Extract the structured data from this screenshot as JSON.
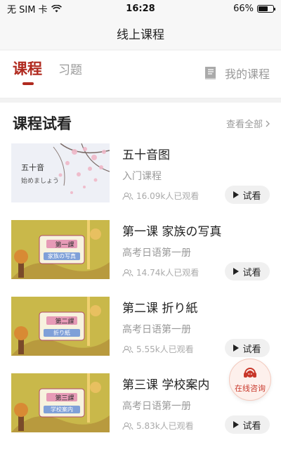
{
  "status_bar": {
    "carrier": "无 SIM 卡",
    "time": "16:28",
    "battery": "66%",
    "battery_level": 0.66
  },
  "nav": {
    "title": "线上课程"
  },
  "tabs": {
    "active": "课程",
    "other": "习题",
    "my_courses": "我的课程"
  },
  "section": {
    "title": "课程试看",
    "view_all": "查看全部"
  },
  "courses": [
    {
      "title": "五十音图",
      "subtitle": "入门课程",
      "views": "16.09k人已观看",
      "button": "试看",
      "thumb": {
        "main": "五十音",
        "sub": "始めましょう"
      }
    },
    {
      "title": "第一课 家族の写真",
      "subtitle": "高考日语第一册",
      "views": "14.74k人已观看",
      "button": "试看",
      "thumb": {
        "main": "第一課",
        "sub": "家族の写真"
      }
    },
    {
      "title": "第二课 折り紙",
      "subtitle": "高考日语第一册",
      "views": "5.55k人已观看",
      "button": "试看",
      "thumb": {
        "main": "第二課",
        "sub": "折り紙"
      }
    },
    {
      "title": "第三课 学校案内",
      "subtitle": "高考日语第一册",
      "views": "5.83k人已观看",
      "button": "试看",
      "thumb": {
        "main": "第三課",
        "sub": "学校案内"
      }
    }
  ],
  "consult": {
    "label": "在线咨询"
  },
  "colors": {
    "accent": "#b02a1f",
    "thumb_bg": "#c9b84a"
  }
}
